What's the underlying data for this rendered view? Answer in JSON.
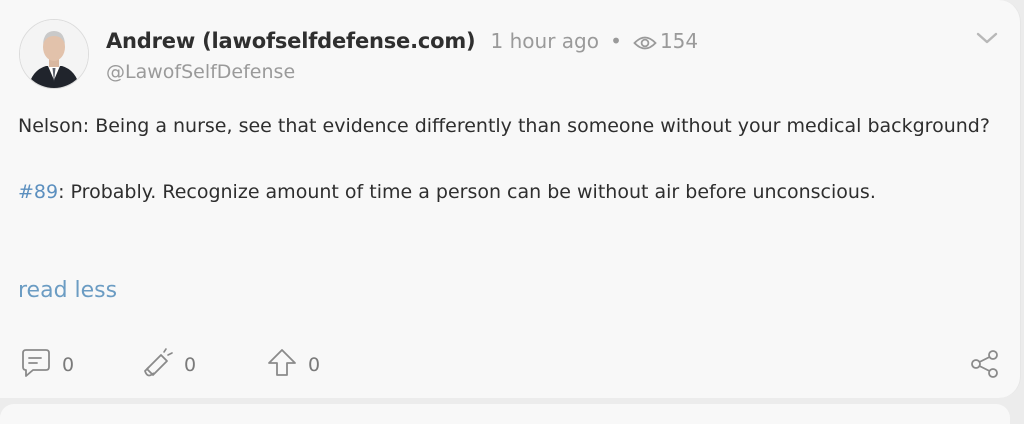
{
  "post": {
    "author_name": "Andrew (lawofselfdefense.com)",
    "time_ago": "1 hour ago",
    "separator": "•",
    "views": "154",
    "handle": "@LawofSelfDefense",
    "paragraph1": "Nelson: Being a nurse, see that evidence differently than someone without your medical background?",
    "tag": "#89",
    "paragraph2_rest": ": Probably. Recognize amount of time a person can be without air before unconscious.",
    "read_less": "read less"
  },
  "actions": {
    "comments_count": "0",
    "boosts_count": "0",
    "upvotes_count": "0"
  },
  "icons": [
    "eye-icon",
    "chevron-down-icon",
    "comment-icon",
    "megaphone-icon",
    "upvote-icon",
    "share-icon"
  ],
  "colors": {
    "link": "#6b9cc3",
    "hashtag": "#5b8fbf",
    "text": "#2e2e2e",
    "muted": "#9a9a9a",
    "card_bg": "#f8f8f8"
  }
}
